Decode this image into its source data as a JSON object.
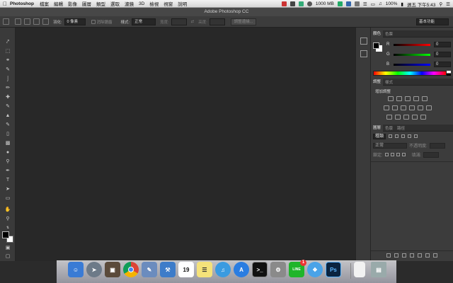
{
  "menubar": {
    "app_name": "Photoshop",
    "menus": [
      "檔案",
      "編輯",
      "影像",
      "圖層",
      "類型",
      "選取",
      "濾鏡",
      "3D",
      "檢視",
      "視窗",
      "說明"
    ],
    "memory": "1000 MB",
    "battery": "100%",
    "clock": "週五 下午5:43"
  },
  "window": {
    "title": "Adobe Photoshop CC"
  },
  "options_bar": {
    "feather_label": "羽化:",
    "feather_value": "0 像素",
    "antialias_label": "消除鋸齒",
    "style_label": "樣式:",
    "style_value": "正常",
    "width_label": "寬度:",
    "height_label": "高度:",
    "refine_button": "調整邊緣...",
    "workspace": "基本功能"
  },
  "color_panel": {
    "tabs": [
      "顏色",
      "色票"
    ],
    "channels": [
      {
        "label": "R",
        "value": "0"
      },
      {
        "label": "G",
        "value": "0"
      },
      {
        "label": "B",
        "value": "0"
      }
    ]
  },
  "adjustments_panel": {
    "tabs": [
      "調整",
      "樣式"
    ],
    "add_label": "增加調整"
  },
  "layers_panel": {
    "tabs": [
      "圖層",
      "色版",
      "路徑"
    ],
    "kind_label": "種類",
    "blend_mode": "正常",
    "opacity_label": "不透明度:",
    "lock_label": "鎖定:",
    "fill_label": "填滿:"
  },
  "colors": {
    "menubar": "#e6e6e6",
    "canvas": "#282828",
    "panel": "#3c3c3c"
  },
  "dock_apps": [
    "finder-icon",
    "launchpad-icon",
    "photo-icon",
    "chrome-icon",
    "preview-icon",
    "xcode-icon",
    "calendar-icon",
    "notes-icon",
    "itunes-icon",
    "app-store-icon",
    "terminal-icon",
    "system-preferences-icon",
    "line-icon",
    "safari-icon",
    "photoshop-icon",
    "document-icon",
    "trash-icon"
  ],
  "dock_labels": {
    "calendar_day": "19",
    "photoshop_label": "Ps",
    "line_label": "LINE",
    "line_badge": "1"
  }
}
